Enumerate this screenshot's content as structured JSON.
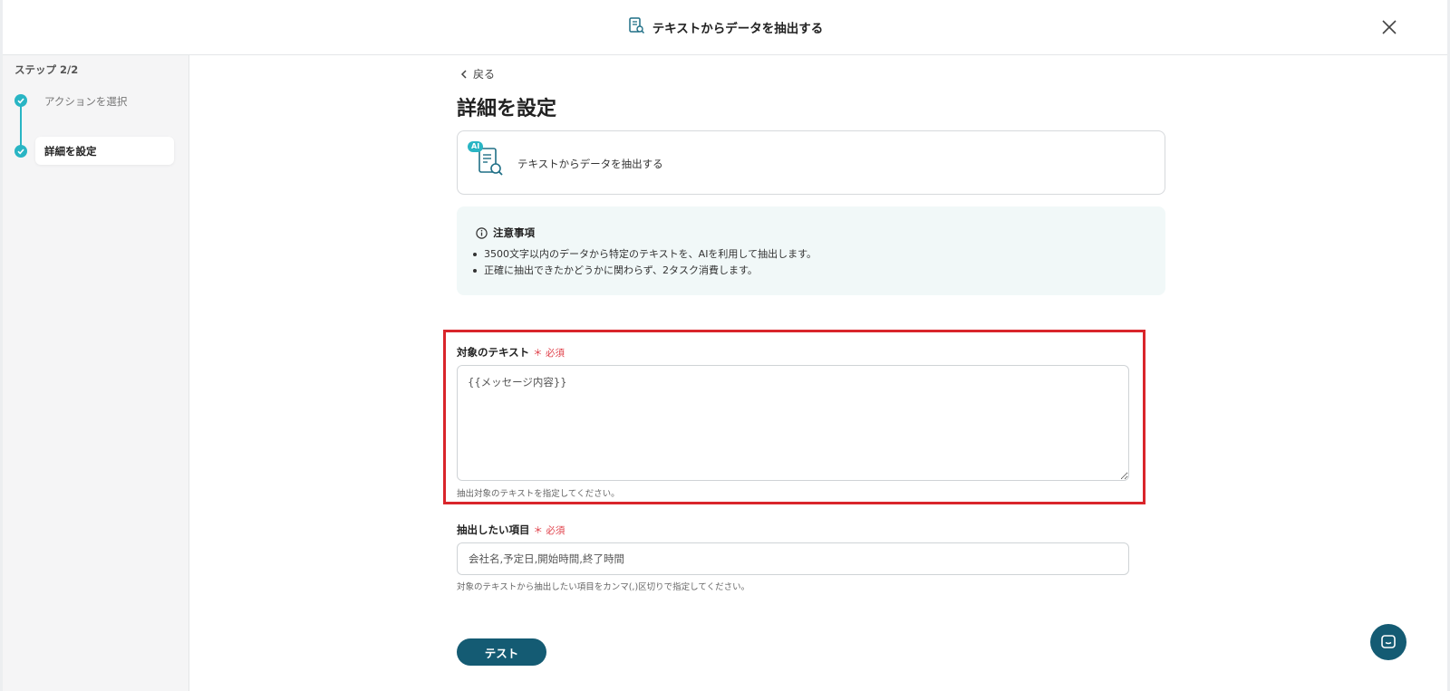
{
  "header": {
    "title": "テキストからデータを抽出する"
  },
  "sidebar": {
    "step_count": "ステップ 2/2",
    "steps": [
      {
        "label": "アクションを選択",
        "state": "done"
      },
      {
        "label": "詳細を設定",
        "state": "active"
      }
    ]
  },
  "main": {
    "back_label": "戻る",
    "page_title": "詳細を設定",
    "action_card": {
      "badge": "AI",
      "label": "テキストからデータを抽出する"
    },
    "notice": {
      "title": "注意事項",
      "items": [
        "3500文字以内のデータから特定のテキストを、AIを利用して抽出します。",
        "正確に抽出できたかどうかに関わらず、2タスク消費します。"
      ]
    },
    "fields": [
      {
        "label": "対象のテキスト",
        "required_mark": "＊ 必須",
        "value": "{{メッセージ内容}}",
        "helper": "抽出対象のテキストを指定してください。"
      },
      {
        "label": "抽出したい項目",
        "required_mark": "＊ 必須",
        "value": "会社名,予定日,開始時間,終了時間",
        "helper": "対象のテキストから抽出したい項目をカンマ(,)区切りで指定してください。"
      }
    ],
    "test_button": "テスト"
  },
  "colors": {
    "accent": "#29b5c4",
    "primary": "#145b73",
    "required": "#e0404a",
    "highlight": "#d9252b",
    "notice_bg": "#f1f8f8"
  },
  "icons": {
    "header": "document-search-icon",
    "close": "close-icon",
    "back": "chevron-left-icon",
    "notice": "info-icon",
    "chat": "chat-icon"
  }
}
